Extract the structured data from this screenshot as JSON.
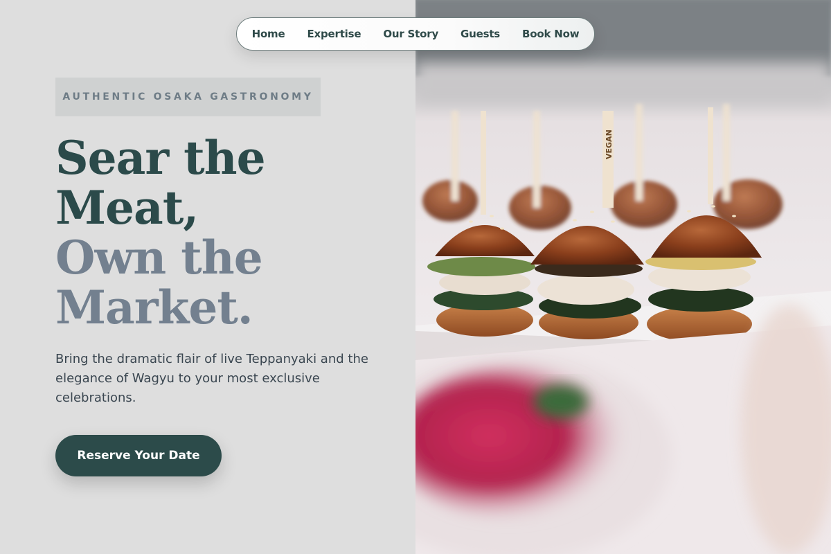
{
  "nav": {
    "items": [
      {
        "label": "Home"
      },
      {
        "label": "Expertise"
      },
      {
        "label": "Our Story"
      },
      {
        "label": "Guests"
      },
      {
        "label": "Book Now"
      }
    ]
  },
  "hero": {
    "eyebrow": "AUTHENTIC OSAKA GASTRONOMY",
    "headline_line1": "Sear the",
    "headline_line2": "Meat,",
    "headline_line3": "Own the",
    "headline_line4": "Market.",
    "description": "Bring the dramatic flair of live Teppanyaki and the elegance of Wagyu to your most exclusive celebrations.",
    "cta_label": "Reserve Your Date"
  },
  "image": {
    "pick_label": "VEGAN",
    "colors": {
      "headline_dark": "#2b4a4a",
      "headline_muted": "#73808f",
      "button_bg": "#2c4b4a"
    }
  }
}
